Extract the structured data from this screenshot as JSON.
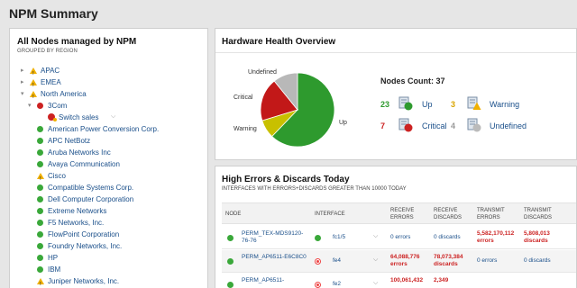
{
  "page_title": "NPM Summary",
  "nodes_panel": {
    "title": "All Nodes managed by NPM",
    "subtitle": "GROUPED BY REGION",
    "items": [
      {
        "label": "APAC",
        "status": "warning",
        "level": 0,
        "expanded": false
      },
      {
        "label": "EMEA",
        "status": "warning",
        "level": 0,
        "expanded": false
      },
      {
        "label": "North America",
        "status": "warning",
        "level": 0,
        "expanded": true
      },
      {
        "label": "3Com",
        "status": "down",
        "level": 1,
        "expanded": true
      },
      {
        "label": "Switch sales",
        "status": "down-partial",
        "level": 2,
        "expanded": false
      },
      {
        "label": "American Power Conversion Corp.",
        "status": "up",
        "level": 1
      },
      {
        "label": "APC NetBotz",
        "status": "up",
        "level": 1
      },
      {
        "label": "Aruba Networks Inc",
        "status": "up",
        "level": 1
      },
      {
        "label": "Avaya Communication",
        "status": "up",
        "level": 1
      },
      {
        "label": "Cisco",
        "status": "warning",
        "level": 1
      },
      {
        "label": "Compatible Systems Corp.",
        "status": "up",
        "level": 1
      },
      {
        "label": "Dell Computer Corporation",
        "status": "up",
        "level": 1
      },
      {
        "label": "Extreme Networks",
        "status": "up",
        "level": 1
      },
      {
        "label": "F5 Networks, Inc.",
        "status": "up",
        "level": 1
      },
      {
        "label": "FlowPoint Corporation",
        "status": "up",
        "level": 1
      },
      {
        "label": "Foundry Networks, Inc.",
        "status": "up",
        "level": 1
      },
      {
        "label": "HP",
        "status": "up",
        "level": 1
      },
      {
        "label": "IBM",
        "status": "up",
        "level": 1
      },
      {
        "label": "Juniper Networks, Inc.",
        "status": "warning",
        "level": 1
      }
    ]
  },
  "hw_panel": {
    "title": "Hardware Health Overview",
    "count_title": "Nodes Count: 37",
    "pie_labels": {
      "undefined": "Undefined",
      "critical": "Critical",
      "warning": "Warning",
      "up": "Up"
    },
    "counts": [
      {
        "num": "23",
        "label": "Up",
        "color": "#2e9a2e"
      },
      {
        "num": "3",
        "label": "Warning",
        "color": "#d9a400"
      },
      {
        "num": "7",
        "label": "Critical",
        "color": "#cc2222"
      },
      {
        "num": "4",
        "label": "Undefined",
        "color": "#999999"
      }
    ],
    "chart_data": {
      "type": "pie",
      "title": "Hardware Health Overview",
      "categories": [
        "Up",
        "Warning",
        "Critical",
        "Undefined"
      ],
      "values": [
        23,
        3,
        7,
        4
      ],
      "colors": [
        "#2e9a2e",
        "#c8c000",
        "#c21818",
        "#b8b8b8"
      ]
    }
  },
  "err_panel": {
    "title": "High Errors & Discards Today",
    "subtitle": "INTERFACES WITH ERRORS+DISCARDS GREATER THAN 10000 TODAY",
    "headers": {
      "node": "NODE",
      "interface": "INTERFACE",
      "recv_errors": "RECEIVE ERRORS",
      "recv_discards": "RECEIVE DISCARDS",
      "trans_errors": "TRANSMIT ERRORS",
      "trans_discards": "TRANSMIT DISCARDS"
    },
    "rows": [
      {
        "node": "PERM_TEX-MDS9120-76-76",
        "interface": "fc1/5",
        "recv_errors": "0 errors",
        "recv_discards": "0 discards",
        "trans_errors": "5,582,170,112 errors",
        "trans_discards": "5,808,013 discards"
      },
      {
        "node": "PERM_AP6511-E6C8C0",
        "interface": "fe4",
        "recv_errors": "64,088,776 errors",
        "recv_discards": "78,073,384 discards",
        "trans_errors": "0 errors",
        "trans_discards": "0 discards"
      },
      {
        "node": "PERM_AP6511-",
        "interface": "fe2",
        "recv_errors": "100,061,432",
        "recv_discards": "2,349",
        "trans_errors": "",
        "trans_discards": ""
      }
    ]
  }
}
